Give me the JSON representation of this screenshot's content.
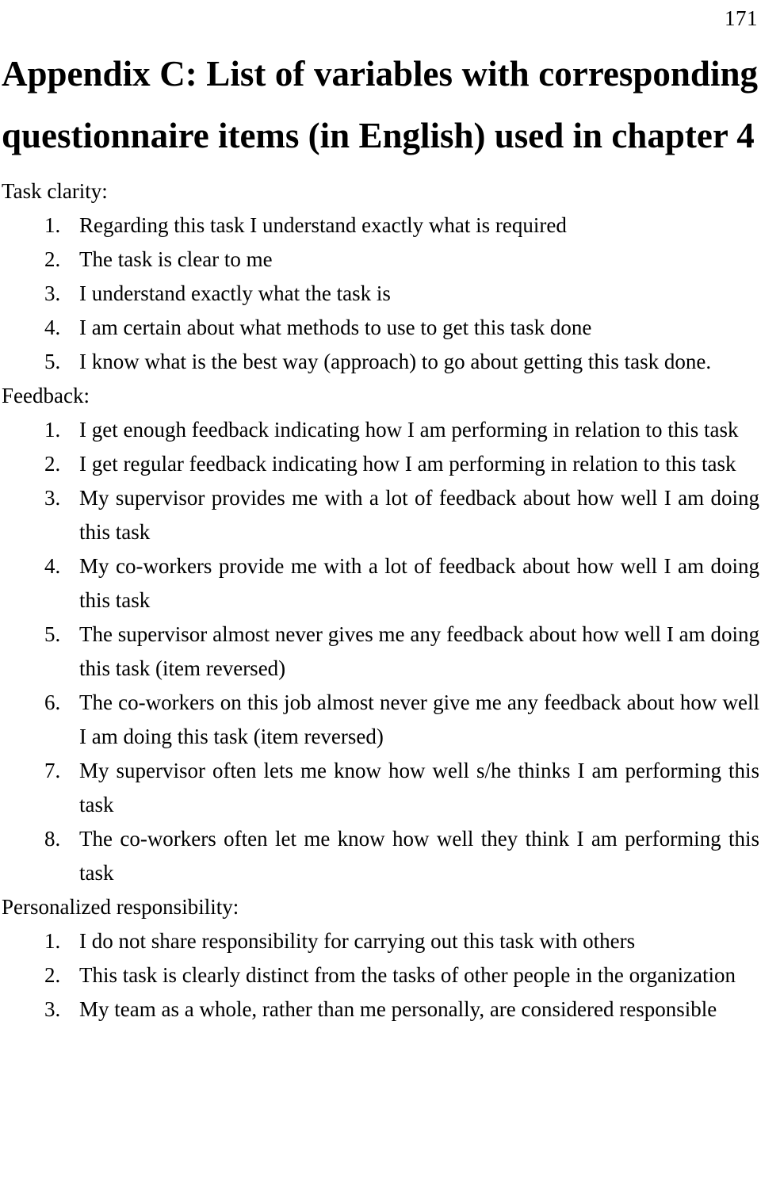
{
  "page": {
    "number": "171"
  },
  "title": "Appendix C: List of variables with corresponding questionnaire items (in English) used in chapter 4",
  "sections": [
    {
      "heading": "Task clarity:",
      "items": [
        {
          "number": "1.",
          "text": "Regarding this task I understand exactly what is required"
        },
        {
          "number": "2.",
          "text": "The task is clear to me"
        },
        {
          "number": "3.",
          "text": "I understand exactly what the task is"
        },
        {
          "number": "4.",
          "text": "I am certain about what methods to use to get this task done"
        },
        {
          "number": "5.",
          "text": "I know what is the best way (approach) to go about getting this task done."
        }
      ]
    },
    {
      "heading": "Feedback:",
      "items": [
        {
          "number": "1.",
          "text": "I get enough feedback indicating how I am performing in relation to this task"
        },
        {
          "number": "2.",
          "text": "I get regular feedback indicating how I am performing in relation to this task"
        },
        {
          "number": "3.",
          "text": "My supervisor provides me with a lot of feedback about how well I am doing this task"
        },
        {
          "number": "4.",
          "text": "My co-workers provide me with a lot of feedback about how well I am doing this task"
        },
        {
          "number": "5.",
          "text": "The supervisor almost never gives me any feedback about how well I am doing this task (item reversed)"
        },
        {
          "number": "6.",
          "text": "The co-workers on this job almost never give me any feedback about how well I am doing this task (item reversed)"
        },
        {
          "number": "7.",
          "text": "My supervisor often lets me know how well s/he thinks I am performing this task"
        },
        {
          "number": "8.",
          "text": "The co-workers often let me know how well they think I am performing this task"
        }
      ]
    },
    {
      "heading": "Personalized responsibility:",
      "items": [
        {
          "number": "1.",
          "text": "I do not share responsibility for carrying out this task with others"
        },
        {
          "number": "2.",
          "text": "This task is clearly distinct from the tasks of other people in the organization"
        },
        {
          "number": "3.",
          "text": "My team as a whole, rather than me personally, are considered responsible"
        }
      ]
    }
  ]
}
